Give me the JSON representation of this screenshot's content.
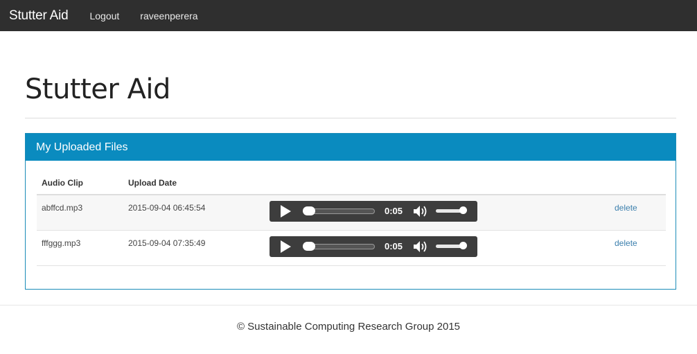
{
  "navbar": {
    "brand": "Stutter Aid",
    "links": [
      "Logout",
      "raveenperera"
    ]
  },
  "page": {
    "title": "Stutter Aid"
  },
  "panel": {
    "heading": "My Uploaded Files",
    "columns": [
      "Audio Clip",
      "Upload Date"
    ],
    "rows": [
      {
        "clip": "abffcd.mp3",
        "date": "2015-09-04 06:45:54",
        "duration": "0:05",
        "action": "delete"
      },
      {
        "clip": "fffggg.mp3",
        "date": "2015-09-04 07:35:49",
        "duration": "0:05",
        "action": "delete"
      }
    ]
  },
  "footer": {
    "text": "© Sustainable Computing Research Group 2015"
  },
  "colors": {
    "navbar": "#2f2f2f",
    "panel_heading": "#0a8bbf",
    "link": "#3b7fad",
    "player": "#3d3d3d"
  },
  "icons": [
    "play-icon",
    "volume-icon"
  ]
}
